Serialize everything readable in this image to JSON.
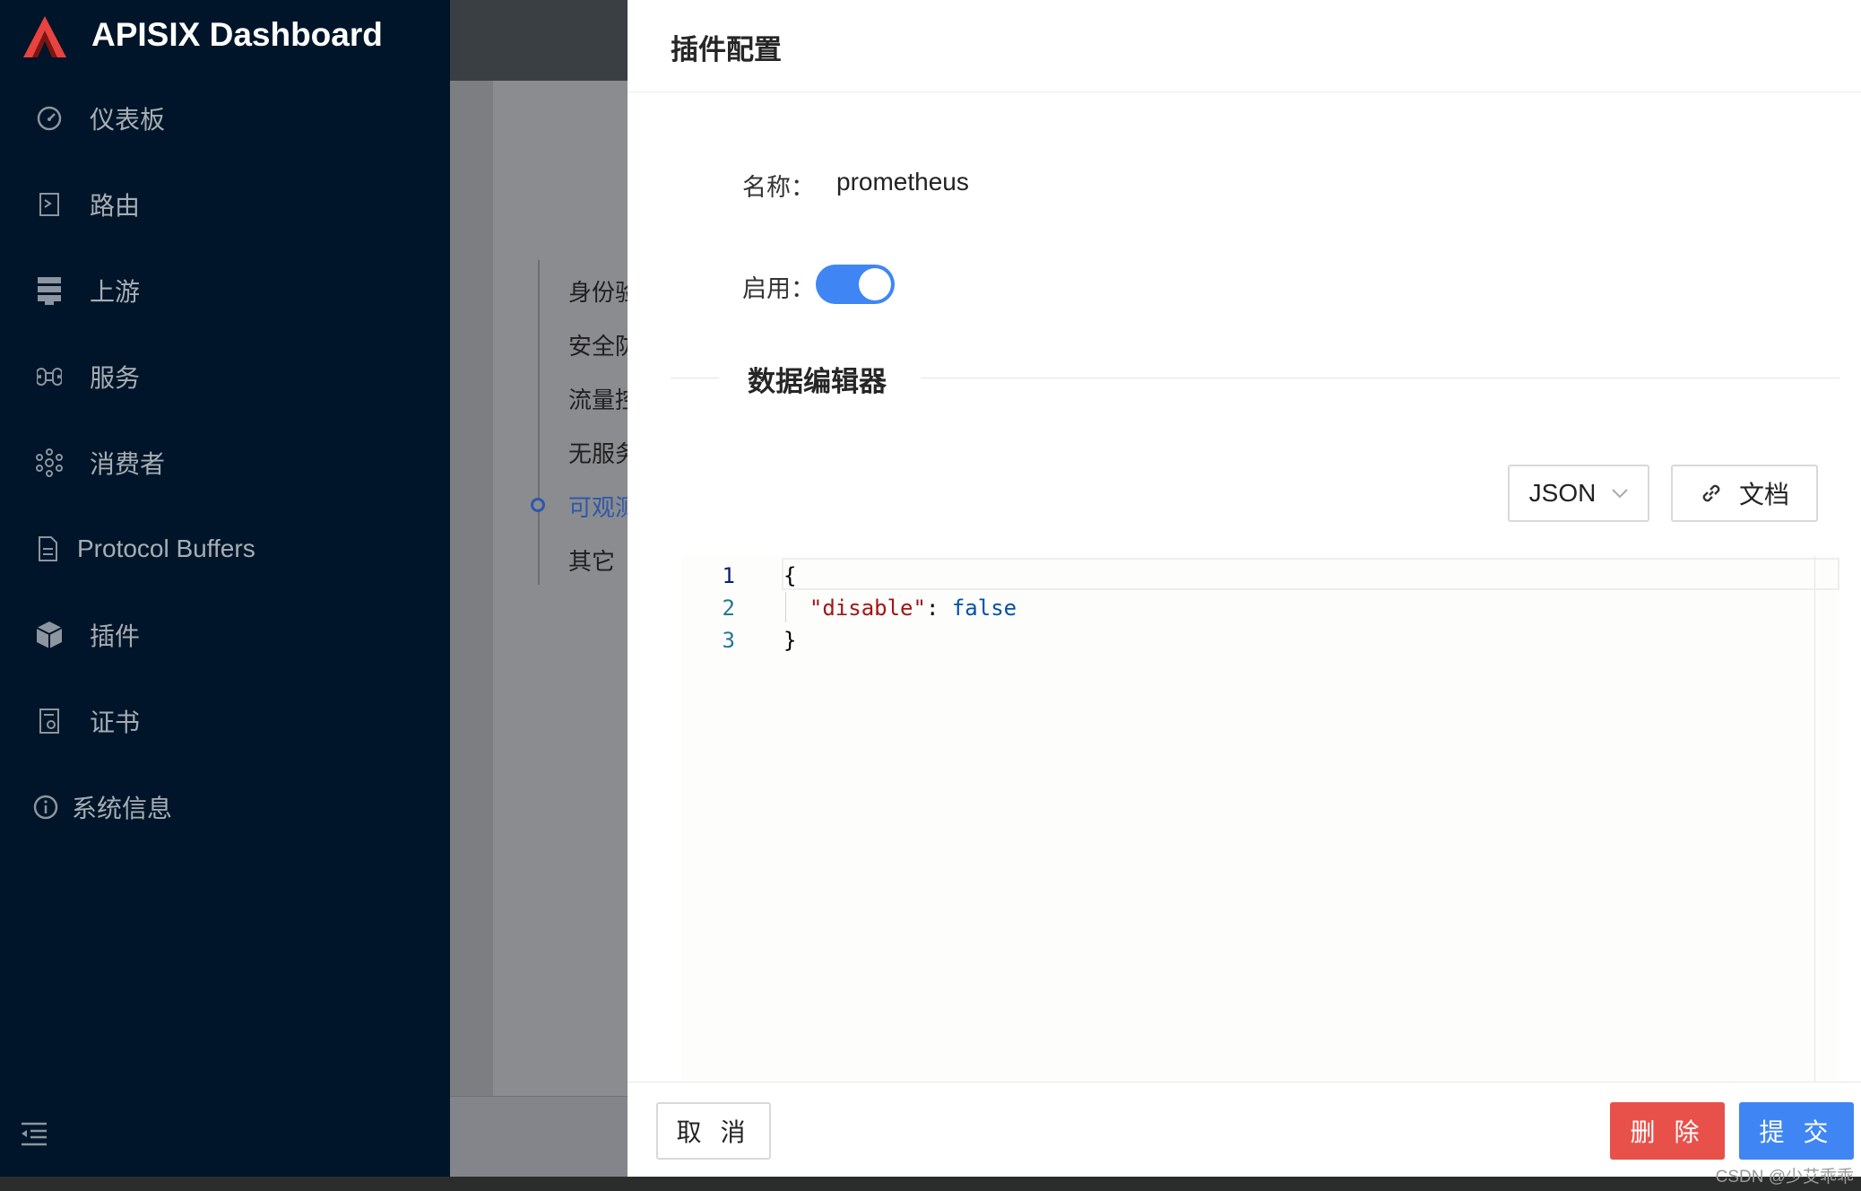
{
  "app": {
    "title": "APISIX Dashboard"
  },
  "sidebar": {
    "items": [
      {
        "label": "仪表板",
        "icon": "dashboard-icon"
      },
      {
        "label": "路由",
        "icon": "route-icon"
      },
      {
        "label": "上游",
        "icon": "database-icon"
      },
      {
        "label": "服务",
        "icon": "command-icon"
      },
      {
        "label": "消费者",
        "icon": "cluster-icon"
      },
      {
        "label": "Protocol Buffers",
        "icon": "file-icon"
      },
      {
        "label": "插件",
        "icon": "cube-icon"
      },
      {
        "label": "证书",
        "icon": "certificate-icon"
      },
      {
        "label": "系统信息",
        "icon": "info-icon"
      }
    ]
  },
  "background_page": {
    "anchors": [
      "身份验",
      "安全防",
      "流量控",
      "无服务",
      "可观测",
      "其它"
    ],
    "active_anchor": "可观测"
  },
  "drawer": {
    "title": "插件配置",
    "name_label": "名称：",
    "name_value": "prometheus",
    "enable_label": "启用：",
    "enabled": true,
    "section_title": "数据编辑器",
    "language_select": "JSON",
    "docs_button": "文档",
    "editor": {
      "line_numbers": [
        "1",
        "2",
        "3"
      ],
      "lines": [
        "{",
        "  \"disable\": false",
        "}"
      ]
    },
    "footer": {
      "cancel": "取 消",
      "delete": "删 除",
      "submit": "提 交"
    }
  },
  "watermark": "CSDN @少艾乖乖",
  "colors": {
    "primary": "#3f86f4",
    "danger": "#e8504a",
    "sidebar": "#001529"
  }
}
